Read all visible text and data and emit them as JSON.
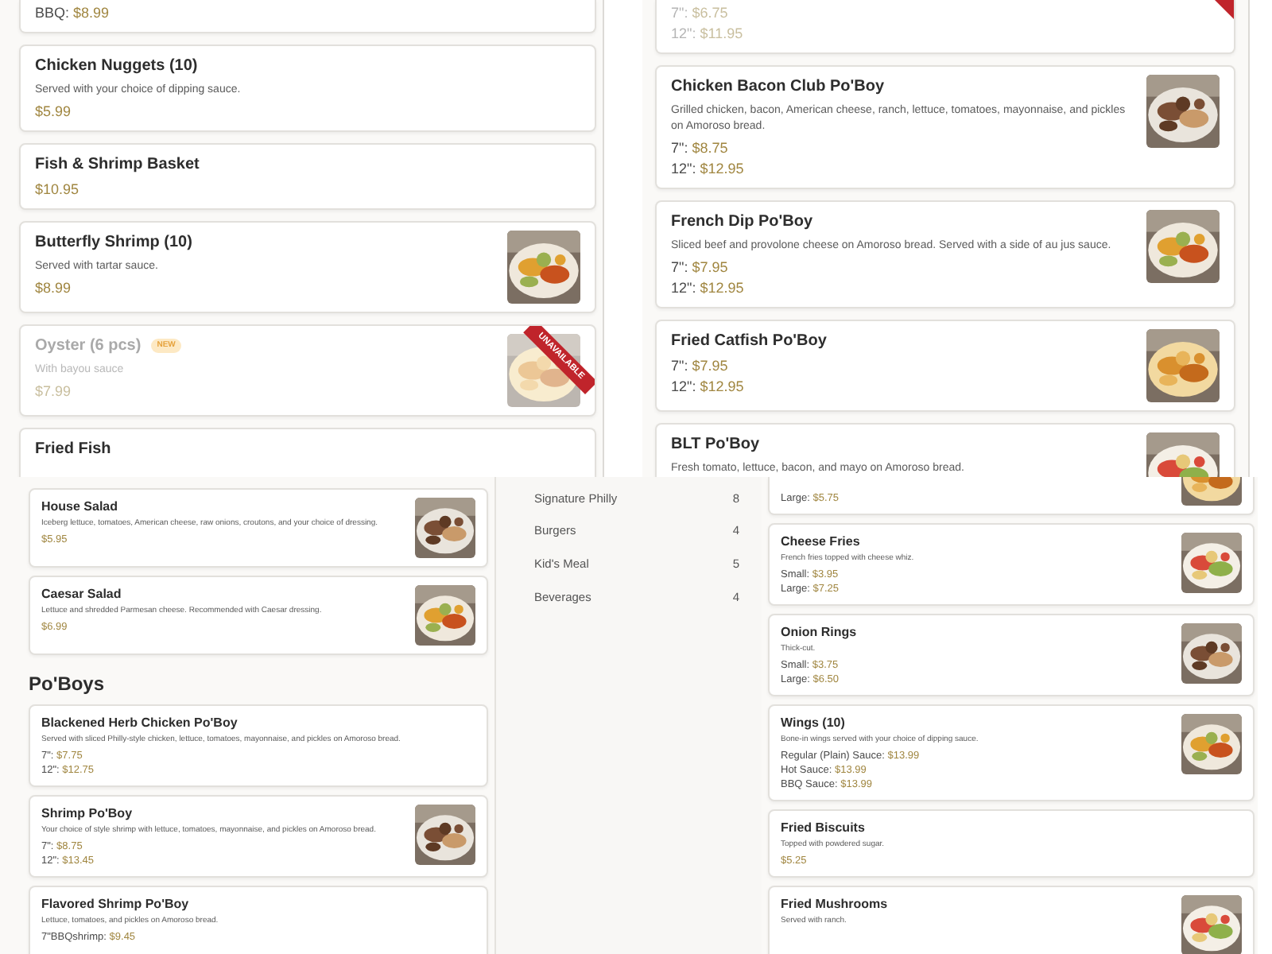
{
  "panels": [
    {
      "kind": "menu",
      "items": [
        {
          "kind": "item",
          "unavailable": false,
          "prices": [
            {
              "label": "BBQ:",
              "amount": "$8.99"
            }
          ]
        },
        {
          "kind": "item",
          "unavailable": false,
          "name": "Chicken Nuggets (10)",
          "description": "Served with your choice of dipping sauce.",
          "prices": [
            {
              "amount": "$5.99"
            }
          ]
        },
        {
          "kind": "item",
          "unavailable": false,
          "name": "Fish & Shrimp Basket",
          "prices": [
            {
              "amount": "$10.95"
            }
          ]
        },
        {
          "kind": "item",
          "unavailable": false,
          "name": "Butterfly Shrimp (10)",
          "description": "Served with tartar sauce.",
          "prices": [
            {
              "amount": "$8.99"
            }
          ],
          "image": {
            "kind": "picture"
          }
        },
        {
          "kind": "item",
          "unavailable": true,
          "name": "Oyster (6 pcs)",
          "badge": "NEW",
          "description": "With bayou sauce",
          "prices": [
            {
              "amount": "$7.99"
            }
          ],
          "image": {
            "kind": "picture"
          },
          "ribbon": "UNAVAILABLE"
        },
        {
          "kind": "item",
          "unavailable": false,
          "name": "Fried Fish"
        }
      ]
    },
    {
      "kind": "menu",
      "items": [
        {
          "kind": "item",
          "unavailable": true,
          "prices": [
            {
              "label": "7\":",
              "amount": "$6.75"
            },
            {
              "label": "12\":",
              "amount": "$11.95"
            }
          ]
        },
        {
          "kind": "item",
          "unavailable": false,
          "name": "Chicken Bacon Club Po'Boy",
          "description": "Grilled chicken, bacon, American cheese, ranch, lettuce, tomatoes, mayonnaise, and pickles on Amoroso bread.",
          "prices": [
            {
              "label": "7\":",
              "amount": "$8.75"
            },
            {
              "label": "12\":",
              "amount": "$12.95"
            }
          ],
          "image": {
            "kind": "picture"
          }
        },
        {
          "kind": "item",
          "unavailable": false,
          "name": "French Dip Po'Boy",
          "description": "Sliced beef and provolone cheese on Amoroso bread. Served with a side of au jus sauce.",
          "prices": [
            {
              "label": "7\":",
              "amount": "$7.95"
            },
            {
              "label": "12\":",
              "amount": "$12.95"
            }
          ],
          "image": {
            "kind": "picture"
          }
        },
        {
          "kind": "item",
          "unavailable": false,
          "name": "Fried Catfish Po'Boy",
          "prices": [
            {
              "label": "7\":",
              "amount": "$7.95"
            },
            {
              "label": "12\":",
              "amount": "$12.95"
            }
          ],
          "image": {
            "kind": "picture"
          }
        },
        {
          "kind": "item",
          "unavailable": false,
          "name": "BLT Po'Boy",
          "description": "Fresh tomato, lettuce, bacon, and mayo on Amoroso bread.",
          "image": {
            "kind": "picture"
          }
        }
      ]
    },
    {
      "kind": "menu",
      "items": [
        {
          "kind": "item",
          "unavailable": false,
          "name": "House Salad",
          "description": "Iceberg lettuce, tomatoes, American cheese, raw onions, croutons, and your choice of dressing.",
          "prices": [
            {
              "amount": "$5.95"
            }
          ],
          "image": {
            "kind": "picture"
          }
        },
        {
          "kind": "item",
          "unavailable": false,
          "name": "Caesar Salad",
          "description": "Lettuce and shredded Parmesan cheese. Recommended with Caesar dressing.",
          "prices": [
            {
              "amount": "$6.99"
            }
          ],
          "image": {
            "kind": "picture"
          }
        },
        {
          "kind": "heading",
          "name": "Po'Boys"
        },
        {
          "kind": "item",
          "unavailable": false,
          "name": "Blackened Herb Chicken Po'Boy",
          "description": "Served with sliced Philly-style chicken, lettuce, tomatoes, mayonnaise, and pickles on Amoroso bread.",
          "prices": [
            {
              "label": "7\":",
              "amount": "$7.75"
            },
            {
              "label": "12\":",
              "amount": "$12.75"
            }
          ]
        },
        {
          "kind": "item",
          "unavailable": false,
          "name": "Shrimp Po'Boy",
          "description": "Your choice of style shrimp with lettuce, tomatoes, mayonnaise, and pickles on Amoroso bread.",
          "prices": [
            {
              "label": "7\":",
              "amount": "$8.75"
            },
            {
              "label": "12\":",
              "amount": "$13.45"
            }
          ],
          "image": {
            "kind": "picture"
          }
        },
        {
          "kind": "item",
          "unavailable": false,
          "name": "Flavored Shrimp Po'Boy",
          "description": "Lettuce, tomatoes, and pickles on Amoroso bread.",
          "prices": [
            {
              "label": "7\"BBQshrimp:",
              "amount": "$9.45"
            }
          ]
        }
      ]
    },
    {
      "kind": "categories",
      "categories": [
        {
          "name": "Signature Philly",
          "count": "8"
        },
        {
          "name": "Burgers",
          "count": "4"
        },
        {
          "name": "Kid's Meal",
          "count": "5"
        },
        {
          "name": "Beverages",
          "count": "4"
        }
      ]
    },
    {
      "kind": "menu",
      "items": [
        {
          "kind": "item",
          "unavailable": false,
          "prices": [
            {
              "label": "Large:",
              "amount": "$5.75"
            }
          ],
          "image": {
            "kind": "picture"
          }
        },
        {
          "kind": "item",
          "unavailable": false,
          "name": "Cheese Fries",
          "description": "French fries topped with cheese whiz.",
          "prices": [
            {
              "label": "Small:",
              "amount": "$3.95"
            },
            {
              "label": "Large:",
              "amount": "$7.25"
            }
          ],
          "image": {
            "kind": "picture"
          }
        },
        {
          "kind": "item",
          "unavailable": false,
          "name": "Onion Rings",
          "description": "Thick-cut.",
          "prices": [
            {
              "label": "Small:",
              "amount": "$3.75"
            },
            {
              "label": "Large:",
              "amount": "$6.50"
            }
          ],
          "image": {
            "kind": "picture"
          }
        },
        {
          "kind": "item",
          "unavailable": false,
          "name": "Wings (10)",
          "description": "Bone-in wings served with your choice of dipping sauce.",
          "prices": [
            {
              "label": "Regular (Plain) Sauce:",
              "amount": "$13.99"
            },
            {
              "label": "Hot Sauce:",
              "amount": "$13.99"
            },
            {
              "label": "BBQ Sauce:",
              "amount": "$13.99"
            }
          ],
          "image": {
            "kind": "picture"
          }
        },
        {
          "kind": "item",
          "unavailable": false,
          "name": "Fried Biscuits",
          "description": "Topped with powdered sugar.",
          "prices": [
            {
              "amount": "$5.25"
            }
          ]
        },
        {
          "kind": "item",
          "unavailable": false,
          "name": "Fried Mushrooms",
          "description": "Served with ranch.",
          "image": {
            "kind": "picture"
          }
        }
      ]
    }
  ]
}
